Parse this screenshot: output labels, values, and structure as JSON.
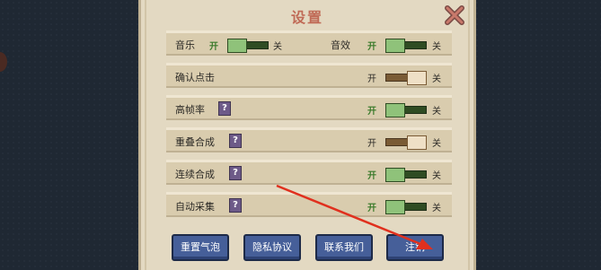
{
  "panel": {
    "title": "设置"
  },
  "icons": {
    "close": "close-x-icon",
    "help": "help-question-icon"
  },
  "colors": {
    "title": "#c06a56",
    "on_text": "#3a7a2a",
    "button": "#465f99",
    "arrow": "#e0301e"
  },
  "rows": {
    "music": {
      "label": "音乐",
      "on_text": "开",
      "off_text": "关",
      "state": "on"
    },
    "sound": {
      "label": "音效",
      "on_text": "开",
      "off_text": "关",
      "state": "on"
    },
    "confirm_click": {
      "label": "确认点击",
      "on_text": "开",
      "off_text": "关",
      "state": "off"
    },
    "high_fps": {
      "label": "高帧率",
      "help": "?",
      "on_text": "开",
      "off_text": "关",
      "state": "on"
    },
    "overlap_merge": {
      "label": "重叠合成",
      "help": "?",
      "on_text": "开",
      "off_text": "关",
      "state": "off"
    },
    "chain_merge": {
      "label": "连续合成",
      "help": "?",
      "on_text": "开",
      "off_text": "关",
      "state": "on"
    },
    "auto_collect": {
      "label": "自动采集",
      "help": "?",
      "on_text": "开",
      "off_text": "关",
      "state": "on"
    }
  },
  "buttons": {
    "reset_bubble": "重置气泡",
    "privacy": "隐私协议",
    "contact": "联系我们",
    "logout": "注销"
  }
}
